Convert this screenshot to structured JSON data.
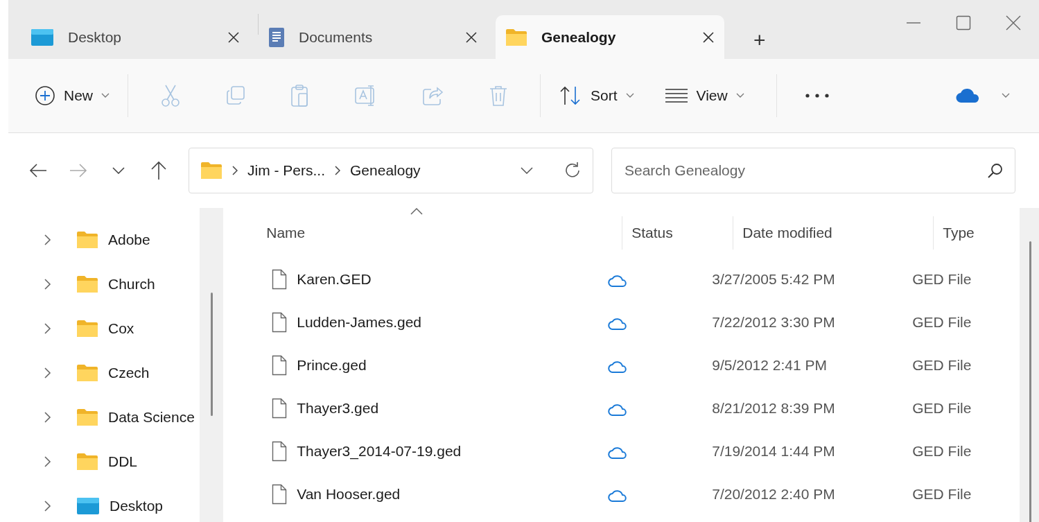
{
  "tabs": [
    {
      "label": "Desktop",
      "kind": "desktop",
      "selected": false
    },
    {
      "label": "Documents",
      "kind": "document",
      "selected": false
    },
    {
      "label": "Genealogy",
      "kind": "folder",
      "selected": true
    }
  ],
  "new_tab": "+",
  "toolbar": [
    {
      "kind": "new",
      "label": "New",
      "disabled": false
    },
    {
      "kind": "cut",
      "disabled": true
    },
    {
      "kind": "copy",
      "disabled": true
    },
    {
      "kind": "paste",
      "disabled": true
    },
    {
      "kind": "rename",
      "disabled": true
    },
    {
      "kind": "share",
      "disabled": true
    },
    {
      "kind": "delete",
      "disabled": true
    },
    {
      "kind": "sort",
      "label": "Sort",
      "disabled": false
    },
    {
      "kind": "view",
      "label": "View",
      "disabled": false
    },
    {
      "kind": "more",
      "disabled": false
    }
  ],
  "nav_buttons": [
    {
      "kind": "back",
      "disabled": false
    },
    {
      "kind": "forward",
      "disabled": true
    },
    {
      "kind": "recent",
      "disabled": false
    },
    {
      "kind": "up",
      "disabled": false
    }
  ],
  "address": {
    "path": [
      "Jim - Pers...",
      "Genealogy"
    ]
  },
  "search": {
    "placeholder": "Search Genealogy"
  },
  "sidebar": {
    "items": [
      {
        "label": "Adobe",
        "kind": "folder",
        "expanded": false
      },
      {
        "label": "Church",
        "kind": "folder",
        "expanded": false
      },
      {
        "label": "Cox",
        "kind": "folder",
        "expanded": false
      },
      {
        "label": "Czech",
        "kind": "folder",
        "expanded": false
      },
      {
        "label": "Data Science",
        "kind": "folder",
        "expanded": false
      },
      {
        "label": "DDL",
        "kind": "folder",
        "expanded": false
      },
      {
        "label": "Desktop",
        "kind": "desktop",
        "expanded": false
      }
    ]
  },
  "table": {
    "columns": [
      {
        "label": "Name",
        "sorted": true
      },
      {
        "label": "Status",
        "sorted": false
      },
      {
        "label": "Date modified",
        "sorted": false
      },
      {
        "label": "Type",
        "sorted": false
      }
    ],
    "rows": [
      {
        "name": "Karen.GED",
        "cloud": true,
        "date": "3/27/2005 5:42 PM",
        "type": "GED File"
      },
      {
        "name": "Ludden-James.ged",
        "cloud": true,
        "date": "7/22/2012 3:30 PM",
        "type": "GED File"
      },
      {
        "name": "Prince.ged",
        "cloud": true,
        "date": "9/5/2012 2:41 PM",
        "type": "GED File"
      },
      {
        "name": "Thayer3.ged",
        "cloud": true,
        "date": "8/21/2012 8:39 PM",
        "type": "GED File"
      },
      {
        "name": "Thayer3_2014-07-19.ged",
        "cloud": true,
        "date": "7/19/2014 1:44 PM",
        "type": "GED File"
      },
      {
        "name": "Van Hooser.ged",
        "cloud": true,
        "date": "7/20/2012 2:40 PM",
        "type": "GED File"
      }
    ]
  }
}
